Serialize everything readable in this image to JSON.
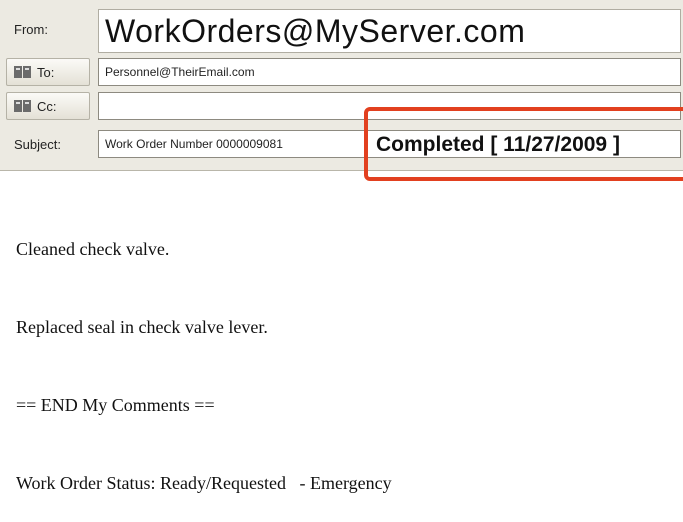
{
  "header": {
    "from_label": "From:",
    "from_value": "WorkOrders@MyServer.com",
    "to_label": "To:",
    "to_value": "Personnel@TheirEmail.com",
    "cc_label": "Cc:",
    "cc_value": "",
    "subject_label": "Subject:",
    "subject_value": "Work Order Number 0000009081",
    "subject_status": "Completed [ 11/27/2009 ]"
  },
  "body": {
    "lines": [
      "Cleaned check valve.",
      "Replaced seal in check valve lever.",
      "== END My Comments ==",
      "Work Order Status: Ready/Requested   - Emergency"
    ]
  },
  "colors": {
    "highlight": "#e2401f",
    "header_bg": "#eceae2"
  }
}
